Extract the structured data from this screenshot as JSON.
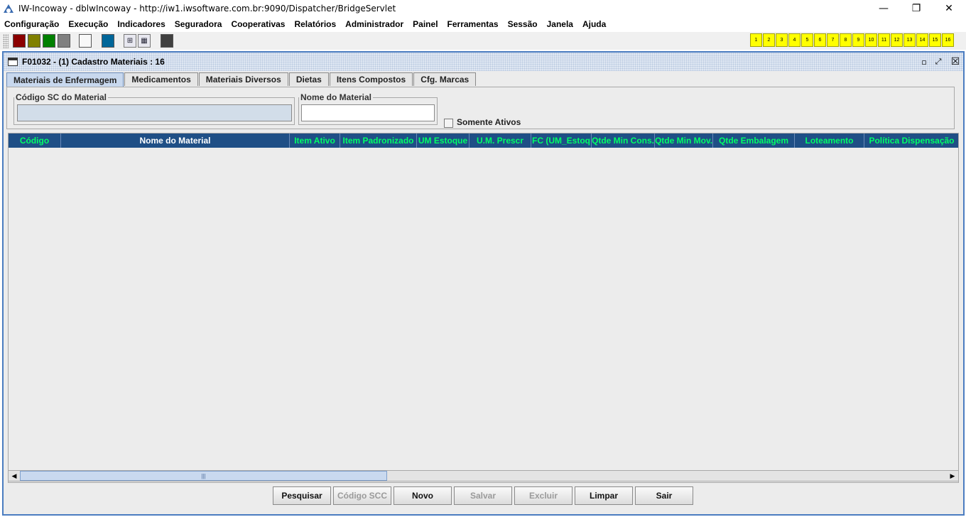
{
  "window": {
    "title": "IW-Incoway - dblwIncoway - http://iw1.iwsoftware.com.br:9090/Dispatcher/BridgeServlet",
    "minimize_icon": "minimize-icon",
    "maximize_icon": "restore-icon",
    "close_icon": "close-icon",
    "minimize_glyph": "—",
    "restore_glyph": "❐",
    "close_glyph": "✕"
  },
  "menu": [
    "Configuração",
    "Execução",
    "Indicadores",
    "Seguradora",
    "Cooperativas",
    "Relatórios",
    "Administrador",
    "Painel",
    "Ferramentas",
    "Sessão",
    "Janela",
    "Ajuda"
  ],
  "toolbar": {
    "swatches": [
      "#8b0000",
      "#808000",
      "#008000",
      "#808080",
      "#f8f8f8",
      "#006699",
      "#404040"
    ],
    "icons": [
      "tree-icon",
      "windows-icon"
    ],
    "icon_glyphs": [
      "⊞",
      "▦"
    ],
    "slots": [
      "1",
      "2",
      "3",
      "4",
      "5",
      "6",
      "7",
      "8",
      "9",
      "10",
      "11",
      "12",
      "13",
      "14",
      "15",
      "16"
    ],
    "slot_color": "#ffff00"
  },
  "frame": {
    "title": "F01032 - (1) Cadastro Materiais : 16",
    "min_glyph": "▫",
    "max_glyph": "⤢",
    "close_glyph": "☒"
  },
  "tabs": [
    {
      "label": "Materiais de Enfermagem",
      "active": true
    },
    {
      "label": "Medicamentos",
      "active": false
    },
    {
      "label": "Materiais Diversos",
      "active": false
    },
    {
      "label": "Dietas",
      "active": false
    },
    {
      "label": "Itens Compostos",
      "active": false
    },
    {
      "label": "Cfg. Marcas",
      "active": false
    }
  ],
  "form": {
    "codigo_label": "Código SC do Material",
    "codigo_value": "",
    "nome_label": "Nome do Material",
    "nome_value": "",
    "somente_ativos_label": "Somente Ativos",
    "somente_ativos_checked": false
  },
  "grid": {
    "columns": [
      {
        "label": "Código",
        "color": "green"
      },
      {
        "label": "Nome do Material",
        "color": "white"
      },
      {
        "label": "Item Ativo",
        "color": "green"
      },
      {
        "label": "Item Padronizado",
        "color": "green"
      },
      {
        "label": "UM Estoque",
        "color": "green"
      },
      {
        "label": "U.M. Prescr",
        "color": "green"
      },
      {
        "label": "FC (UM_Estoq",
        "color": "green"
      },
      {
        "label": "Qtde Min Cons.",
        "color": "green"
      },
      {
        "label": "Qtde Min Mov.",
        "color": "green"
      },
      {
        "label": "Qtde Embalagem",
        "color": "green"
      },
      {
        "label": "Loteamento",
        "color": "green"
      },
      {
        "label": "Política Dispensação",
        "color": "green"
      }
    ],
    "rows": [],
    "header_bg": "#1f4f86",
    "scroll_left": "◀",
    "scroll_right": "▶",
    "scroll_grip": "|||"
  },
  "buttons": [
    {
      "label": "Pesquisar",
      "enabled": true
    },
    {
      "label": "Código SCC",
      "enabled": false
    },
    {
      "label": "Novo",
      "enabled": true
    },
    {
      "label": "Salvar",
      "enabled": false
    },
    {
      "label": "Excluir",
      "enabled": false
    },
    {
      "label": "Limpar",
      "enabled": true
    },
    {
      "label": "Sair",
      "enabled": true
    }
  ]
}
